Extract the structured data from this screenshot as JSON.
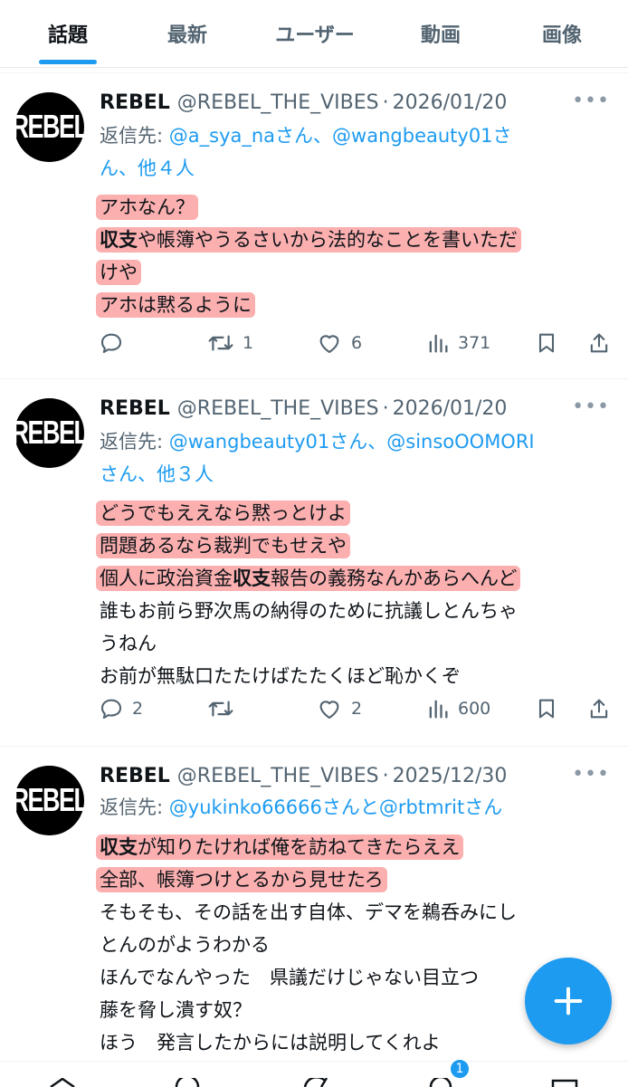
{
  "tabs": [
    {
      "label": "話題",
      "active": true
    },
    {
      "label": "最新",
      "active": false
    },
    {
      "label": "ユーザー",
      "active": false
    },
    {
      "label": "動画",
      "active": false
    },
    {
      "label": "画像",
      "active": false
    }
  ],
  "tweets": [
    {
      "avatar_text": "REBEL",
      "name": "REBEL",
      "handle": "@REBEL_THE_VIBES",
      "separator": "·",
      "date": "2026/01/20",
      "reply_prefix": "返信先: ",
      "reply_mentions_line1": "@a_sya_naさん、@wangbeauty01さ",
      "reply_line2": "ん、他４人",
      "body": [
        "アホなん？",
        "収支や帳簿やうるさいから法的なことを書いただ",
        "けや",
        "アホは黙るように"
      ],
      "bold_word": "収支",
      "body_line2_rest": "や帳簿やうるさいから法的なことを書いただ",
      "replies": "",
      "retweets": "1",
      "likes": "6",
      "views": "371"
    },
    {
      "avatar_text": "REBEL",
      "name": "REBEL",
      "handle": "@REBEL_THE_VIBES",
      "separator": "·",
      "date": "2026/01/20",
      "reply_prefix": "返信先: ",
      "reply_mentions_line1": "@wangbeauty01さん、@sinsoOOMORI",
      "reply_line2": "さん、他３人",
      "body": [
        "どうでもええなら黙っとけよ",
        "問題あるなら裁判でもせえや",
        "個人に政治資金収支報告の義務なんかあらへんど",
        "誰もお前ら野次馬の納得のために抗議しとんちゃ",
        "うねん",
        "お前が無駄口たたけばたたくほど恥かくぞ"
      ],
      "line3_a": "個人に政治資金",
      "line3_bold": "収支",
      "line3_b": "報告の義務なんかあらへんど",
      "replies": "2",
      "retweets": "",
      "likes": "2",
      "views": "600"
    },
    {
      "avatar_text": "REBEL",
      "name": "REBEL",
      "handle": "@REBEL_THE_VIBES",
      "separator": "·",
      "date": "2025/12/30",
      "reply_prefix": "返信先: ",
      "reply_mentions_line1": "@yukinko66666さんと@rbtmritさん",
      "body": [
        "収支が知りたければ俺を訪ねてきたらええ",
        "全部、帳簿つけとるから見せたろ",
        "そもそも、その話を出す自体、デマを鵜呑みにし",
        "とんのがようわかる",
        "ほんでなんやった　県議だけじゃない目立つ",
        "藤を脅し潰す奴？",
        "ほう　発言したからには説明してくれよ"
      ],
      "line1_bold": "収支",
      "line1_rest": "が知りたければ俺を訪ねてきたらええ"
    }
  ],
  "fab_icon": "plus-icon",
  "notification_badge": "1",
  "colors": {
    "accent": "#1d9bf0",
    "highlight": "#f86e6e",
    "muted": "#536471"
  }
}
